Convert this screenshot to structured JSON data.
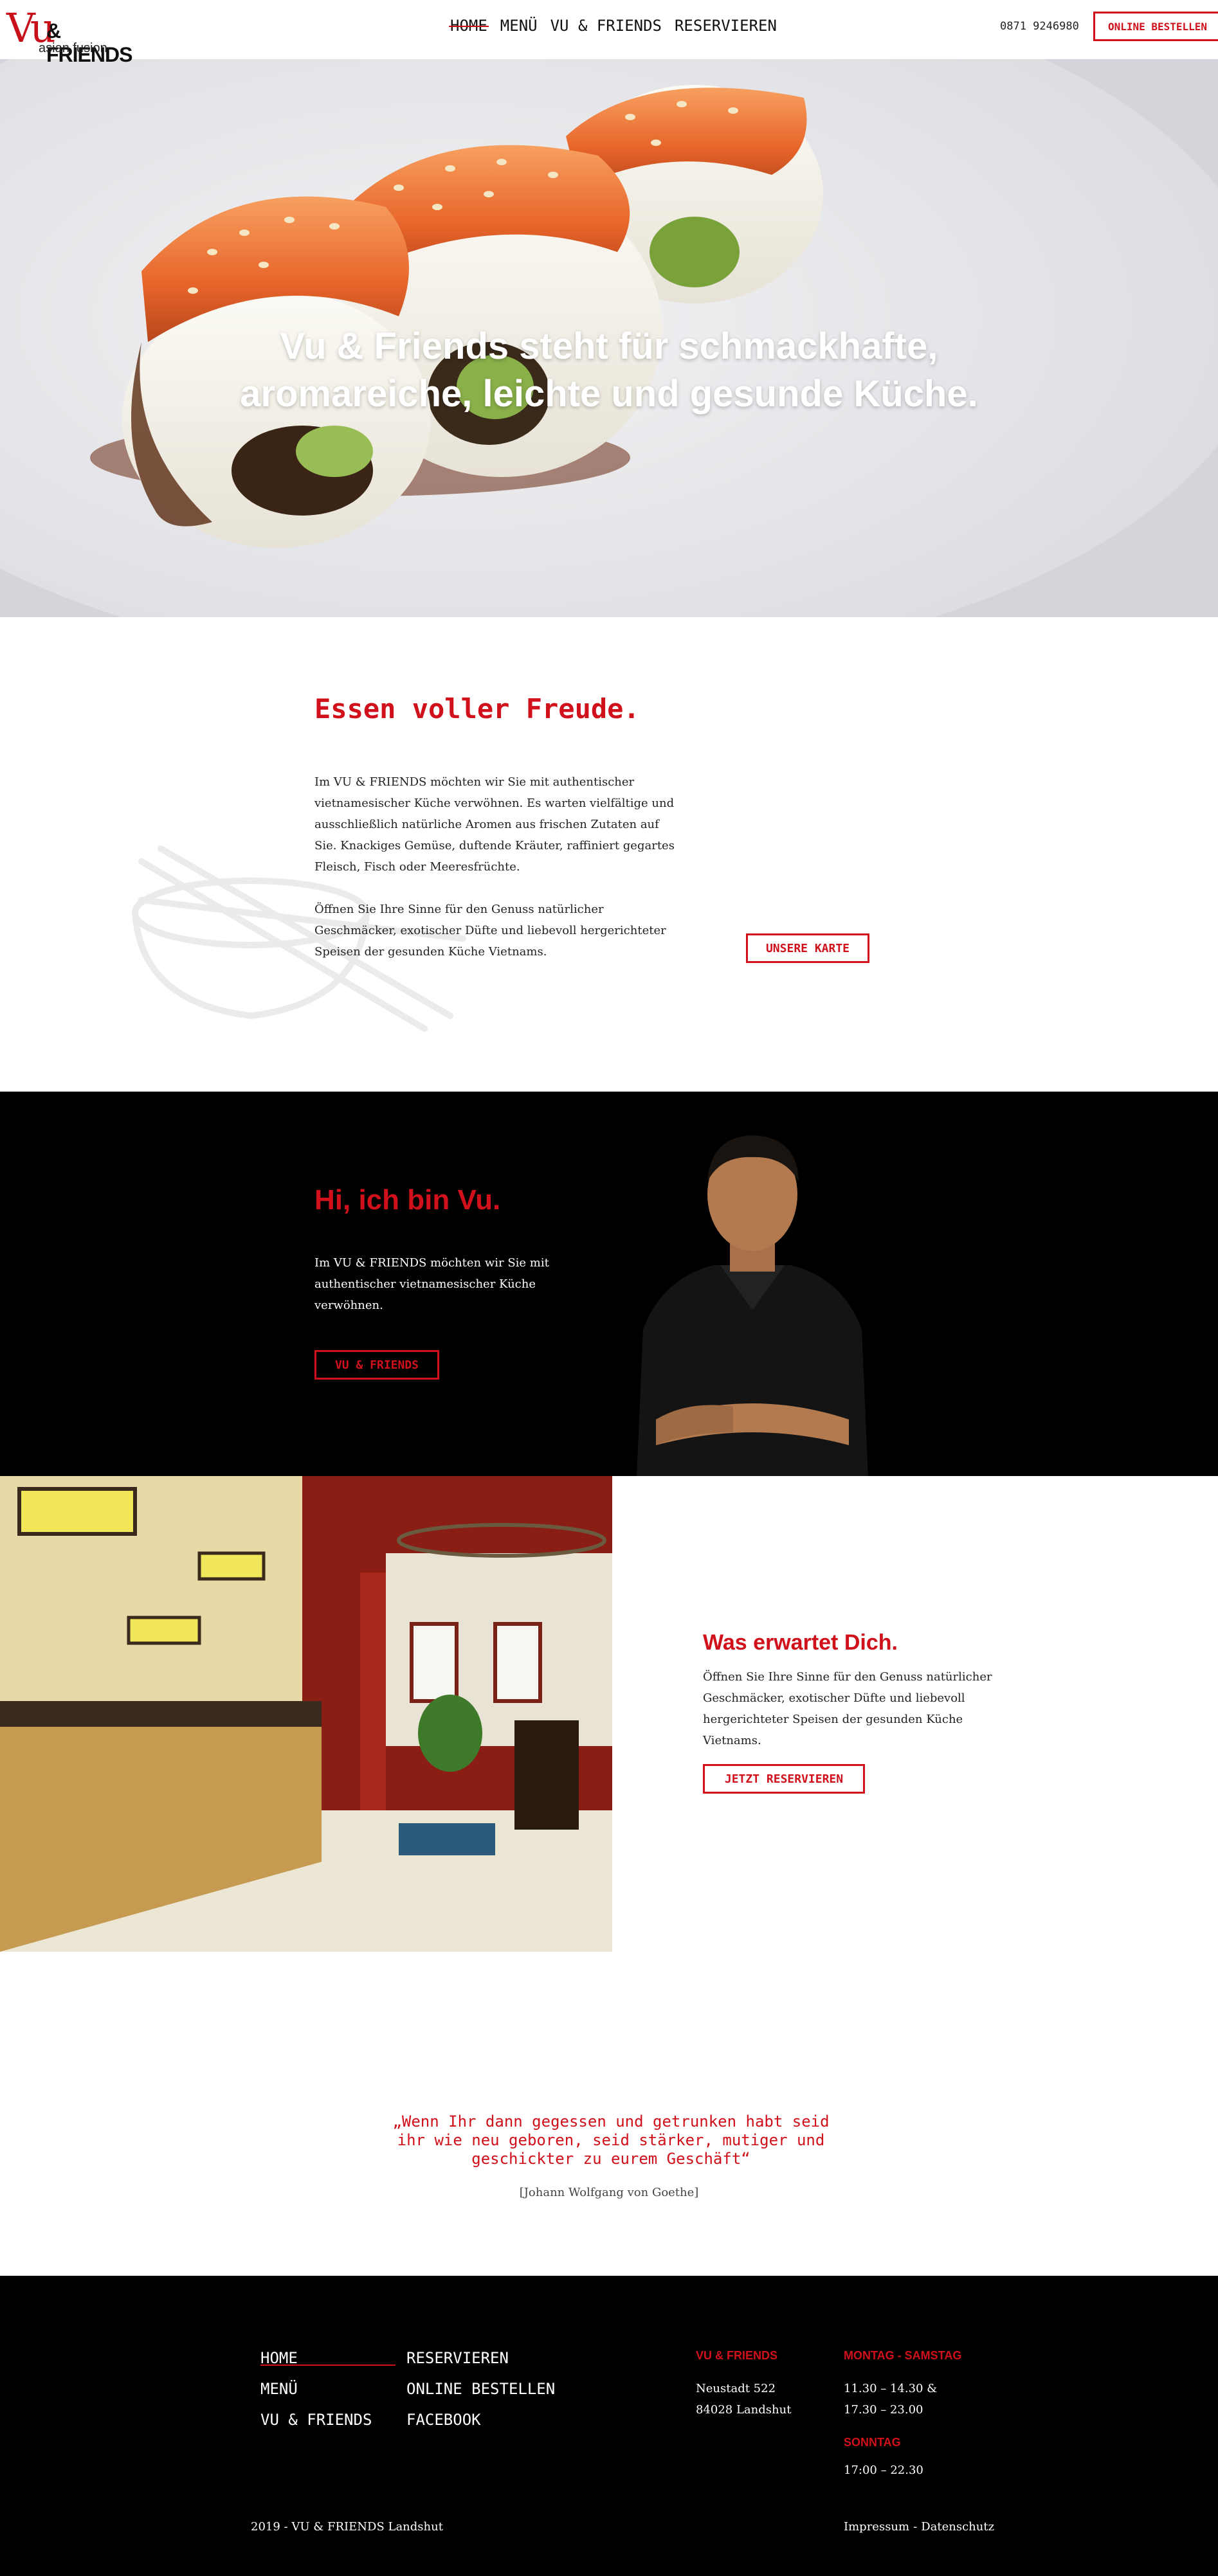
{
  "header": {
    "logo_vu": "Vu",
    "logo_friends": "& FRIENDS",
    "logo_sub": "asian fusion",
    "nav": [
      {
        "label": "HOME",
        "active": true
      },
      {
        "label": "MENÜ",
        "active": false
      },
      {
        "label": "VU & FRIENDS",
        "active": false
      },
      {
        "label": "RESERVIEREN",
        "active": false
      }
    ],
    "phone": "0871 9246980",
    "order_label": "ONLINE BESTELLEN"
  },
  "hero": {
    "line1": "Vu & Friends steht für schmackhafte,",
    "line2": "aromareiche, leichte und gesunde Küche."
  },
  "intro": {
    "title": "Essen voller Freude.",
    "paragraph1": "Im VU & FRIENDS möchten wir Sie mit authentischer vietnamesischer Küche verwöhnen. Es warten vielfältige und ausschließlich natürliche Aromen aus frischen Zutaten auf Sie. Knackiges Gemüse, duftende Kräuter, raffiniert gegartes Fleisch, Fisch oder Meeresfrüchte.",
    "paragraph2": "Öffnen Sie Ihre Sinne für den Genuss natürlicher Geschmäcker, exotischer Düfte und liebevoll hergerichteter Speisen der gesunden Küche Vietnams.",
    "button": "UNSERE KARTE"
  },
  "vu": {
    "title": "Hi, ich bin Vu.",
    "text": "Im VU & FRIENDS möchten wir Sie mit authentischer vietnamesischer Küche verwöhnen.",
    "button": "VU & FRIENDS"
  },
  "restaurant": {
    "title": "Was erwartet Dich.",
    "text": "Öffnen Sie Ihre Sinne für den Genuss natürlicher Geschmäcker, exotischer Düfte und liebevoll hergerichteter Speisen der gesunden Küche Vietnams.",
    "button": "JETZT RESERVIEREN"
  },
  "quote": {
    "line1": "„Wenn Ihr dann gegessen und getrunken habt seid",
    "line2": "ihr wie neu geboren, seid stärker, mutiger und",
    "line3": "geschickter zu eurem Geschäft“",
    "author": "[Johann Wolfgang von Goethe]"
  },
  "footer": {
    "nav_col1": [
      "HOME",
      "MENÜ",
      "VU & FRIENDS"
    ],
    "nav_col2": [
      "RESERVIEREN",
      "ONLINE BESTELLEN",
      "FACEBOOK"
    ],
    "address_head": "VU & FRIENDS",
    "address_line1": "Neustadt 522",
    "address_line2": "84028 Landshut",
    "hours_head": "MONTAG - SAMSTAG",
    "hours_line1": "11.30 – 14.30 &",
    "hours_line2": "17.30 – 23.00",
    "sunday_head": "SONNTAG",
    "sunday_line": "17:00 – 22.30",
    "copyright": "2019 - VU & FRIENDS Landshut",
    "impressum": "Impressum",
    "sep": "-",
    "datenschutz": "Datenschutz"
  },
  "colors": {
    "accent": "#d0101a",
    "footer_bg": "#000000"
  }
}
